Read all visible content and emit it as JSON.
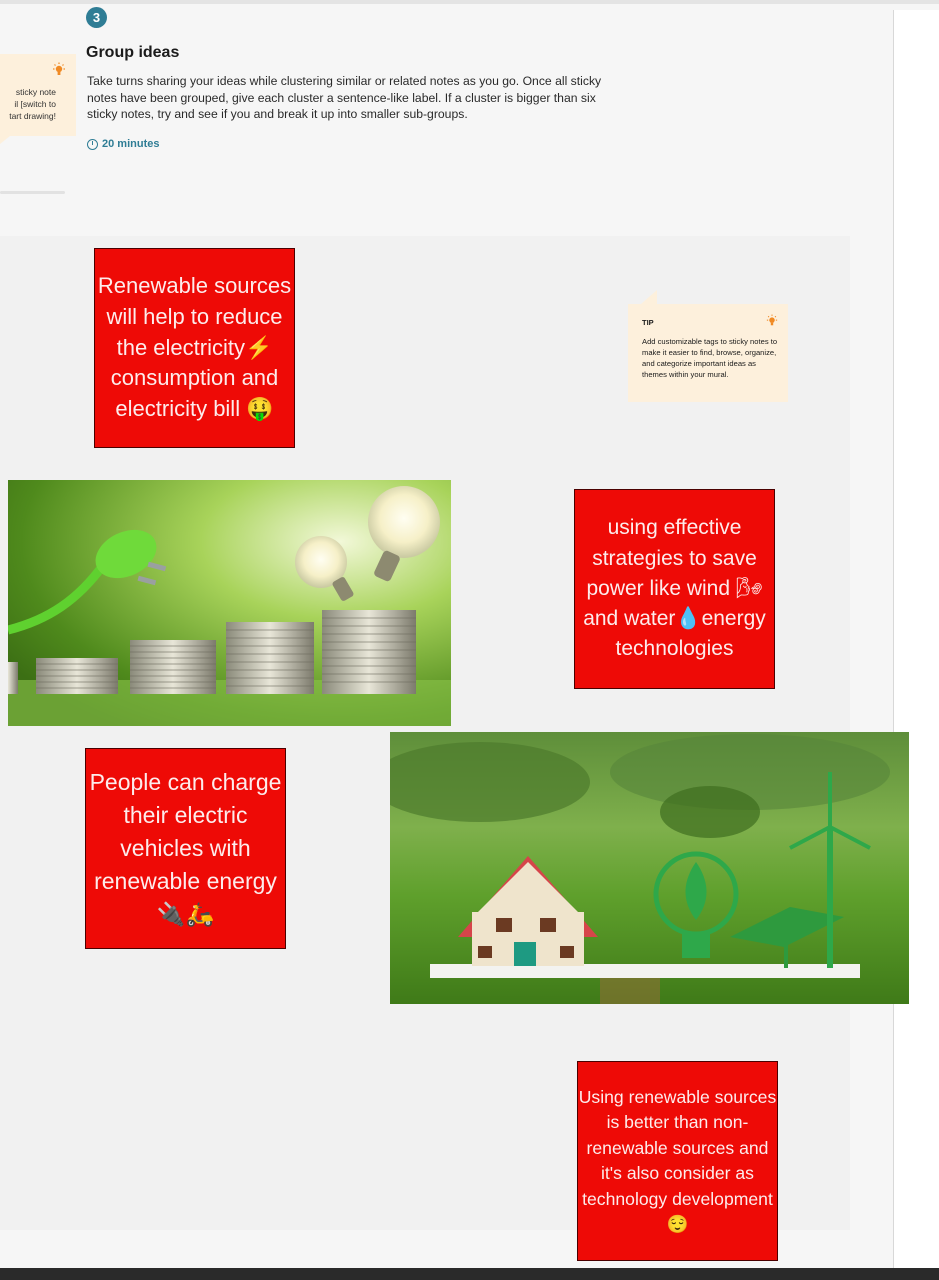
{
  "step": {
    "number": "3",
    "title": "Group ideas",
    "description": "Take turns sharing your ideas while clustering similar or related notes as you go. Once all sticky notes have been grouped, give each cluster a sentence-like label. If a cluster is bigger than six sticky notes, try and see if you and break it up into smaller sub-groups.",
    "duration": "20 minutes"
  },
  "left_tip": {
    "text": "sticky note\nil [switch to\ntart drawing!"
  },
  "tip_card": {
    "label": "TIP",
    "text": "Add customizable tags to sticky notes to make it easier to find, browse, organize, and categorize important ideas as themes within your mural."
  },
  "sticky_notes": [
    {
      "text": "Renewable sources will help to reduce the electricity⚡ consumption and electricity bill 🤑"
    },
    {
      "text": "using effective strategies to save power like wind 🌬 and water💧energy technologies"
    },
    {
      "text": "People can charge their electric vehicles with renewable energy 🔌🛵"
    },
    {
      "text": "Using renewable sources is better than non-renewable sources and it's also consider as technology development 😌"
    }
  ],
  "images": {
    "photo1": {
      "icon": "coins-bulbs-plug-image"
    },
    "photo2": {
      "icon": "house-bulb-windmill-image"
    }
  },
  "colors": {
    "sticky": "#ee0a06",
    "tip_bg": "#fdf0dc",
    "accent": "#2f7d95"
  }
}
